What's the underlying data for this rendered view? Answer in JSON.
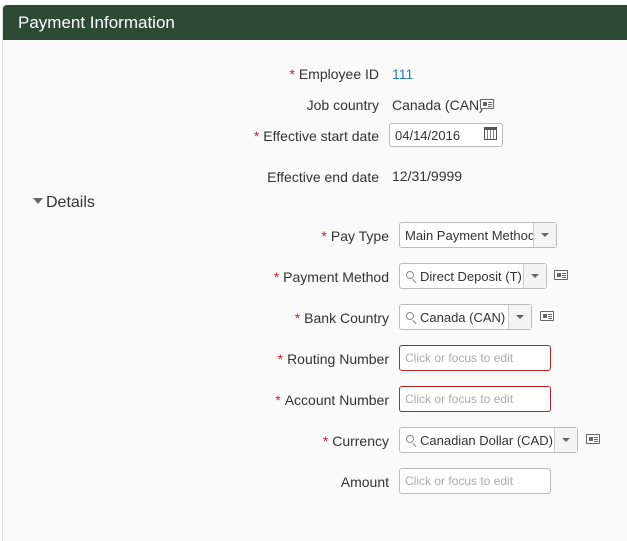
{
  "header": {
    "title": "Payment Information"
  },
  "fields": {
    "employee_id": {
      "label": "Employee ID",
      "value": "111"
    },
    "job_country": {
      "label": "Job country",
      "value": "Canada (CAN)"
    },
    "effective_start_date": {
      "label": "Effective start date",
      "value": "04/14/2016"
    },
    "effective_end_date": {
      "label": "Effective end date",
      "value": "12/31/9999"
    }
  },
  "details": {
    "label": "Details",
    "pay_type": {
      "label": "Pay Type",
      "value": "Main Payment Method"
    },
    "payment_method": {
      "label": "Payment Method",
      "value": "Direct Deposit (T)"
    },
    "bank_country": {
      "label": "Bank Country",
      "value": "Canada (CAN)"
    },
    "routing_number": {
      "label": "Routing Number",
      "placeholder": "Click or focus to edit"
    },
    "account_number": {
      "label": "Account Number",
      "placeholder": "Click or focus to edit"
    },
    "currency": {
      "label": "Currency",
      "value": "Canadian Dollar (CAD)"
    },
    "amount": {
      "label": "Amount",
      "placeholder": "Click or focus to edit"
    }
  },
  "required_marker": "*",
  "icons": {
    "info_card": "id-card-icon",
    "calendar": "calendar-icon",
    "search": "search-icon",
    "dropdown": "chevron-down-icon",
    "section_toggle": "triangle-down-icon"
  },
  "colors": {
    "header_bg": "#2c4a34",
    "required": "#d2232a",
    "link": "#2a79b8",
    "error_border": "#b4232a"
  }
}
